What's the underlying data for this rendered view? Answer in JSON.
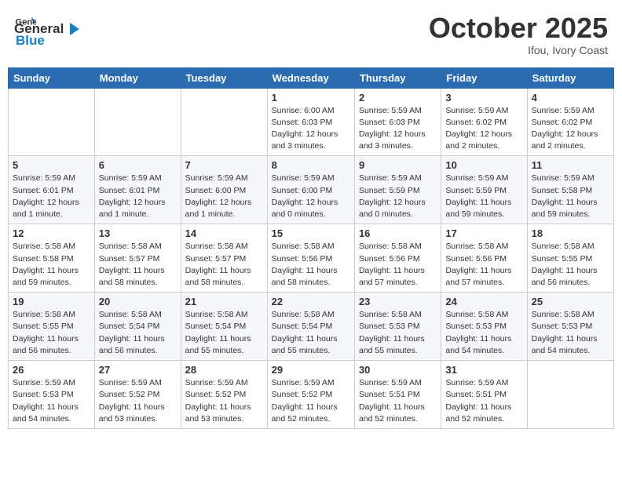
{
  "header": {
    "logo_general": "General",
    "logo_blue": "Blue",
    "month": "October 2025",
    "location": "Ifou, Ivory Coast"
  },
  "weekdays": [
    "Sunday",
    "Monday",
    "Tuesday",
    "Wednesday",
    "Thursday",
    "Friday",
    "Saturday"
  ],
  "weeks": [
    [
      {
        "day": "",
        "info": ""
      },
      {
        "day": "",
        "info": ""
      },
      {
        "day": "",
        "info": ""
      },
      {
        "day": "1",
        "info": "Sunrise: 6:00 AM\nSunset: 6:03 PM\nDaylight: 12 hours\nand 3 minutes."
      },
      {
        "day": "2",
        "info": "Sunrise: 5:59 AM\nSunset: 6:03 PM\nDaylight: 12 hours\nand 3 minutes."
      },
      {
        "day": "3",
        "info": "Sunrise: 5:59 AM\nSunset: 6:02 PM\nDaylight: 12 hours\nand 2 minutes."
      },
      {
        "day": "4",
        "info": "Sunrise: 5:59 AM\nSunset: 6:02 PM\nDaylight: 12 hours\nand 2 minutes."
      }
    ],
    [
      {
        "day": "5",
        "info": "Sunrise: 5:59 AM\nSunset: 6:01 PM\nDaylight: 12 hours\nand 1 minute."
      },
      {
        "day": "6",
        "info": "Sunrise: 5:59 AM\nSunset: 6:01 PM\nDaylight: 12 hours\nand 1 minute."
      },
      {
        "day": "7",
        "info": "Sunrise: 5:59 AM\nSunset: 6:00 PM\nDaylight: 12 hours\nand 1 minute."
      },
      {
        "day": "8",
        "info": "Sunrise: 5:59 AM\nSunset: 6:00 PM\nDaylight: 12 hours\nand 0 minutes."
      },
      {
        "day": "9",
        "info": "Sunrise: 5:59 AM\nSunset: 5:59 PM\nDaylight: 12 hours\nand 0 minutes."
      },
      {
        "day": "10",
        "info": "Sunrise: 5:59 AM\nSunset: 5:59 PM\nDaylight: 11 hours\nand 59 minutes."
      },
      {
        "day": "11",
        "info": "Sunrise: 5:59 AM\nSunset: 5:58 PM\nDaylight: 11 hours\nand 59 minutes."
      }
    ],
    [
      {
        "day": "12",
        "info": "Sunrise: 5:58 AM\nSunset: 5:58 PM\nDaylight: 11 hours\nand 59 minutes."
      },
      {
        "day": "13",
        "info": "Sunrise: 5:58 AM\nSunset: 5:57 PM\nDaylight: 11 hours\nand 58 minutes."
      },
      {
        "day": "14",
        "info": "Sunrise: 5:58 AM\nSunset: 5:57 PM\nDaylight: 11 hours\nand 58 minutes."
      },
      {
        "day": "15",
        "info": "Sunrise: 5:58 AM\nSunset: 5:56 PM\nDaylight: 11 hours\nand 58 minutes."
      },
      {
        "day": "16",
        "info": "Sunrise: 5:58 AM\nSunset: 5:56 PM\nDaylight: 11 hours\nand 57 minutes."
      },
      {
        "day": "17",
        "info": "Sunrise: 5:58 AM\nSunset: 5:56 PM\nDaylight: 11 hours\nand 57 minutes."
      },
      {
        "day": "18",
        "info": "Sunrise: 5:58 AM\nSunset: 5:55 PM\nDaylight: 11 hours\nand 56 minutes."
      }
    ],
    [
      {
        "day": "19",
        "info": "Sunrise: 5:58 AM\nSunset: 5:55 PM\nDaylight: 11 hours\nand 56 minutes."
      },
      {
        "day": "20",
        "info": "Sunrise: 5:58 AM\nSunset: 5:54 PM\nDaylight: 11 hours\nand 56 minutes."
      },
      {
        "day": "21",
        "info": "Sunrise: 5:58 AM\nSunset: 5:54 PM\nDaylight: 11 hours\nand 55 minutes."
      },
      {
        "day": "22",
        "info": "Sunrise: 5:58 AM\nSunset: 5:54 PM\nDaylight: 11 hours\nand 55 minutes."
      },
      {
        "day": "23",
        "info": "Sunrise: 5:58 AM\nSunset: 5:53 PM\nDaylight: 11 hours\nand 55 minutes."
      },
      {
        "day": "24",
        "info": "Sunrise: 5:58 AM\nSunset: 5:53 PM\nDaylight: 11 hours\nand 54 minutes."
      },
      {
        "day": "25",
        "info": "Sunrise: 5:58 AM\nSunset: 5:53 PM\nDaylight: 11 hours\nand 54 minutes."
      }
    ],
    [
      {
        "day": "26",
        "info": "Sunrise: 5:59 AM\nSunset: 5:53 PM\nDaylight: 11 hours\nand 54 minutes."
      },
      {
        "day": "27",
        "info": "Sunrise: 5:59 AM\nSunset: 5:52 PM\nDaylight: 11 hours\nand 53 minutes."
      },
      {
        "day": "28",
        "info": "Sunrise: 5:59 AM\nSunset: 5:52 PM\nDaylight: 11 hours\nand 53 minutes."
      },
      {
        "day": "29",
        "info": "Sunrise: 5:59 AM\nSunset: 5:52 PM\nDaylight: 11 hours\nand 52 minutes."
      },
      {
        "day": "30",
        "info": "Sunrise: 5:59 AM\nSunset: 5:51 PM\nDaylight: 11 hours\nand 52 minutes."
      },
      {
        "day": "31",
        "info": "Sunrise: 5:59 AM\nSunset: 5:51 PM\nDaylight: 11 hours\nand 52 minutes."
      },
      {
        "day": "",
        "info": ""
      }
    ]
  ]
}
